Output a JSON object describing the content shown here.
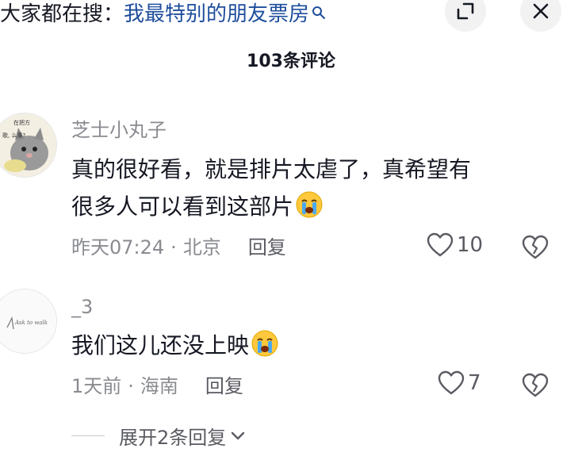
{
  "header": {
    "search_prefix": "大家都在搜：",
    "search_term": "我最特别的朋友票房",
    "icons": {
      "search": "search-icon",
      "expand": "expand-icon",
      "close": "close-icon"
    }
  },
  "comments_panel": {
    "count_label": "103条评论"
  },
  "comments": [
    {
      "username": "芝士小丸子",
      "avatar_text": [
        "在把方",
        "歌, 么事?"
      ],
      "text_line1": "真的很好看，就是排片太虐了，真希望有",
      "text_line2": "很多人可以看到这部片",
      "emoji": "crying-emoji",
      "time": "昨天07:24",
      "location": "北京",
      "reply_label": "回复",
      "likes": "10"
    },
    {
      "username": "_3",
      "avatar_text": "Ask to walk",
      "text": "我们这儿还没上映",
      "emoji": "crying-emoji",
      "time": "1天前",
      "location": "海南",
      "reply_label": "回复",
      "likes": "7",
      "expand_label": "展开2条回复"
    }
  ],
  "colors": {
    "search_term": "#1e4d9c",
    "secondary_text": "#8a8b91",
    "button_bg": "#f2f2f2"
  }
}
